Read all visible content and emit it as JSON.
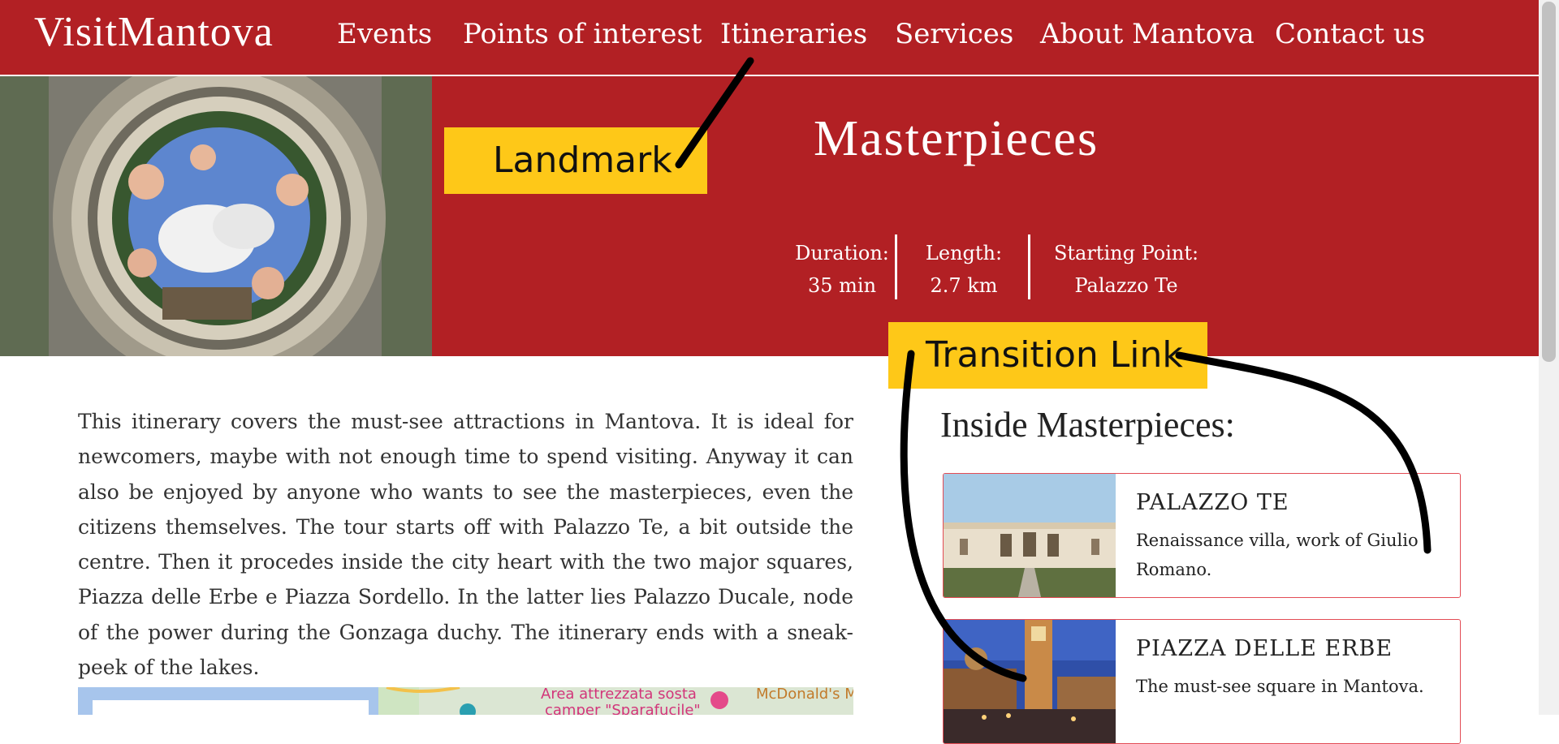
{
  "logo": "VisitMantova",
  "nav": {
    "items": [
      "Events",
      "Points of interest",
      "Itineraries",
      "Services",
      "About Mantova",
      "Contact us"
    ]
  },
  "hero": {
    "title": "Masterpieces",
    "stats": [
      {
        "label": "Duration:",
        "value": "35 min"
      },
      {
        "label": "Length:",
        "value": "2.7 km"
      },
      {
        "label": "Starting Point:",
        "value": "Palazzo Te"
      }
    ]
  },
  "annotations": {
    "landmark": "Landmark",
    "transition": "Transition Link"
  },
  "intro": "This itinerary covers the must-see attractions in Mantova. It is ideal for newcomers, maybe with not enough time to spend visiting. Anyway it can also be enjoyed by anyone who wants to see the masterpieces, even the citizens themselves. The tour starts off with Palazzo Te, a bit outside the centre. Then it procedes inside the city heart with the two major squares, Piazza delle Erbe e Piazza Sordello. In the latter lies Palazzo Ducale, node of the power during the Gonzaga duchy. The itinerary ends with a sneak-peek of the lakes.",
  "inside": {
    "title": "Inside Masterpieces:",
    "cards": [
      {
        "name": "PALAZZO TE",
        "desc": "Renaissance villa, work of Giulio Romano."
      },
      {
        "name": "PIAZZA DELLE ERBE",
        "desc": "The must-see square in Mantova."
      }
    ]
  },
  "map": {
    "labels": [
      "Area attrezzata sosta",
      "camper \"Sparafucile\"",
      "McDonald's M"
    ]
  },
  "colors": {
    "brand": "#b22024",
    "annotation": "#fec818",
    "card_border": "#e34c55"
  }
}
